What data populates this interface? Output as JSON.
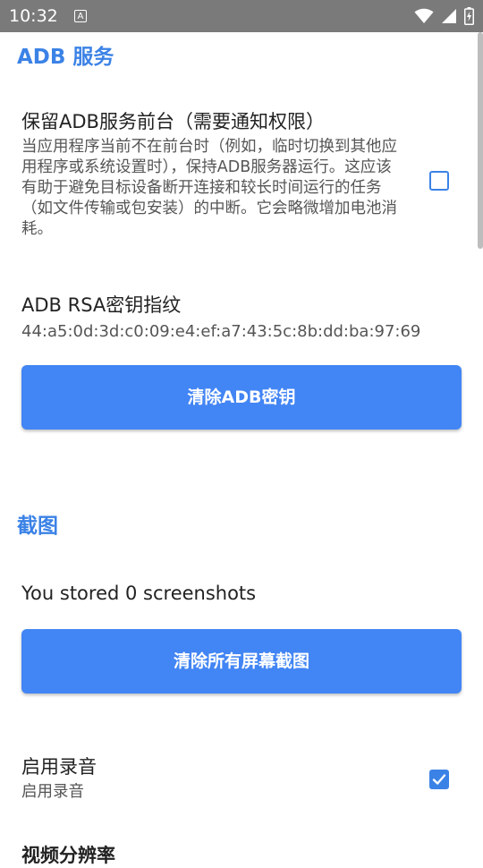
{
  "status_bar": {
    "time": "10:32",
    "notification_glyph": "A",
    "icons": [
      "wifi-icon",
      "signal-icon",
      "battery-charging-icon"
    ]
  },
  "adb_section": {
    "header": "ADB 服务",
    "foreground": {
      "title": "保留ADB服务前台（需要通知权限）",
      "summary": "当应用程序当前不在前台时（例如，临时切换到其他应用程序或系统设置时），保持ADB服务器运行。这应该有助于避免目标设备断开连接和较长时间运行的任务（如文件传输或包安装）的中断。它会略微增加电池消耗。",
      "checked": false
    },
    "rsa": {
      "title": "ADB RSA密钥指纹",
      "fingerprint": "44:a5:0d:3d:c0:09:e4:ef:a7:43:5c:8b:dd:ba:97:69"
    },
    "clear_keys_button": "清除ADB密钥"
  },
  "screenshot_section": {
    "header": "截图",
    "stored_text": "You stored 0 screenshots",
    "clear_screenshots_button": "清除所有屏幕截图"
  },
  "audio": {
    "title": "启用录音",
    "summary": "启用录音",
    "checked": true
  },
  "video_resolution": {
    "title": "视频分辨率"
  },
  "colors": {
    "accent": "#3b82e6",
    "button": "#4285f4",
    "status_bar": "#7a7a7a"
  }
}
